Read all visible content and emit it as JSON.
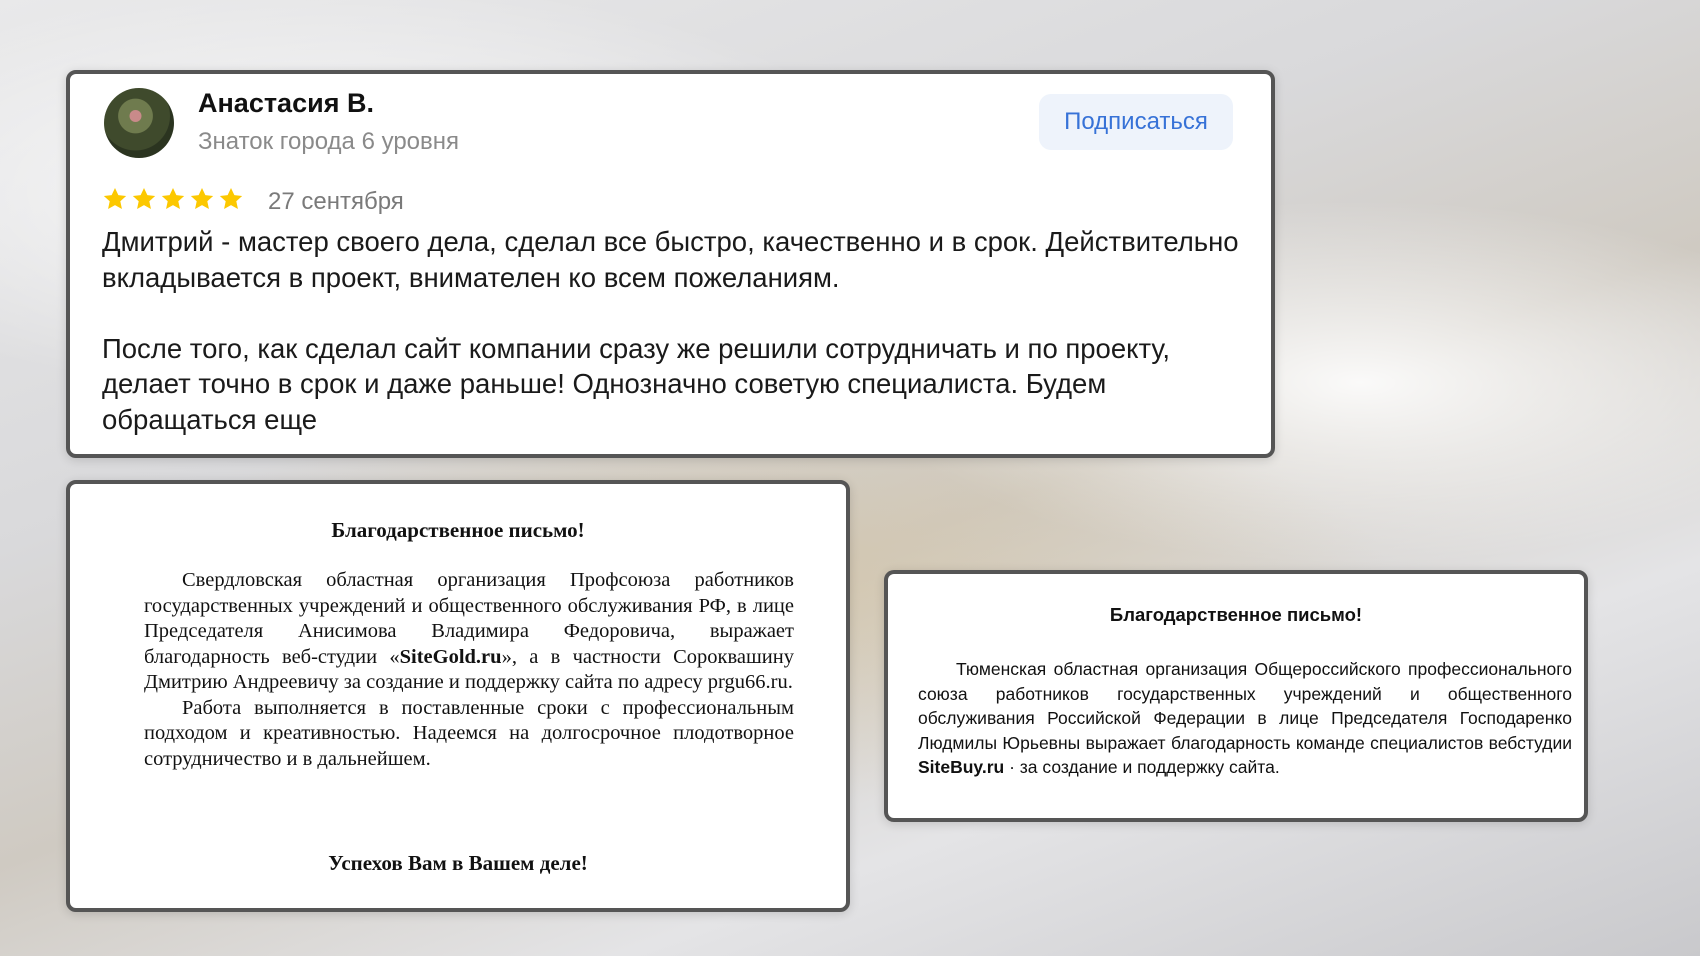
{
  "review": {
    "author": "Анастасия В.",
    "level": "Знаток города 6 уровня",
    "subscribe_label": "Подписаться",
    "rating": 5,
    "rating_max": 5,
    "star_color": "#fcc800",
    "date": "27 сентября",
    "paragraph1": "Дмитрий - мастер своего дела, сделал все быстро, качественно и в срок. Действительно вкладывается в проект, внимателен ко всем пожеланиям.",
    "paragraph2": "После того, как сделал сайт компании сразу же решили сотрудничать и по проекту, делает точно в срок и даже раньше! Однозначно советую специалиста. Будем обращаться еще"
  },
  "letter1": {
    "title": "Благодарственное письмо!",
    "p1_before": "Свердловская областная организация Профсоюза работников государственных учреждений и общественного обслуживания РФ, в лице Председателя Анисимова Владимира Федоровича, выражает благодарность веб-студии «",
    "p1_brand": "SiteGold.ru",
    "p1_after": "», а в частности Сороквашину Дмитрию Андреевичу за создание и поддержку сайта по адресу prgu66.ru.",
    "p2": "Работа выполняется в поставленные сроки с профессиональным подходом и креативностью. Надеемся на долгосрочное плодотворное сотрудничество и в дальнейшем.",
    "closing": "Успехов Вам в Вашем деле!"
  },
  "letter2": {
    "title": "Благодарственное письмо!",
    "p1_before": "Тюменская областная организация Общероссийского профессионального союза работников государственных учреждений и общественного обслуживания Российской Федерации в лице Председателя Господаренко Людмилы Юрьевны выражает благодарность команде специалистов вебстудии ",
    "p1_brand": "SiteBuy.ru",
    "p1_after": " · за создание и поддержку сайта."
  }
}
